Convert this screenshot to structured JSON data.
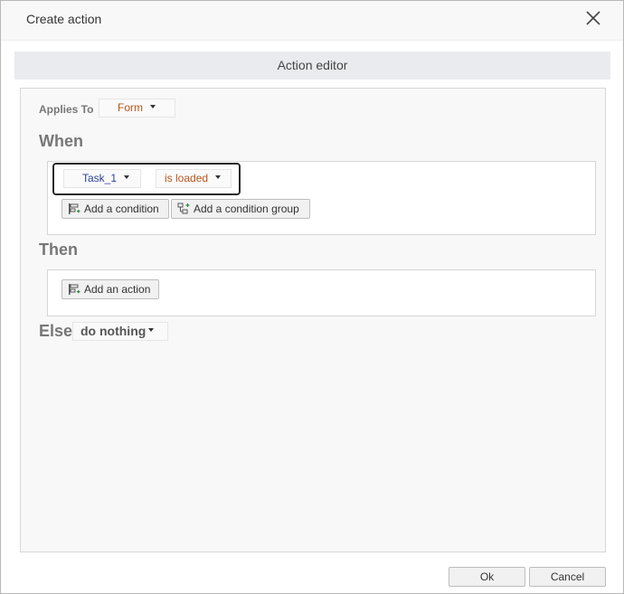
{
  "dialog": {
    "title": "Create action",
    "close_icon": "close-icon"
  },
  "editor": {
    "title": "Action editor",
    "applies_to": {
      "label": "Applies To",
      "value": "Form"
    },
    "when": {
      "title": "When",
      "condition": {
        "target": "Task_1",
        "event": "is loaded"
      },
      "add_condition_label": "Add a condition",
      "add_condition_group_label": "Add a condition group"
    },
    "then": {
      "title": "Then",
      "add_action_label": "Add an action"
    },
    "else": {
      "title": "Else",
      "value": "do nothing"
    }
  },
  "footer": {
    "ok_label": "Ok",
    "cancel_label": "Cancel"
  },
  "colors": {
    "target_text": "#2b3f9a",
    "value_text": "#b4551a",
    "icon_green": "#2e8b3e",
    "section_title": "#777777"
  }
}
